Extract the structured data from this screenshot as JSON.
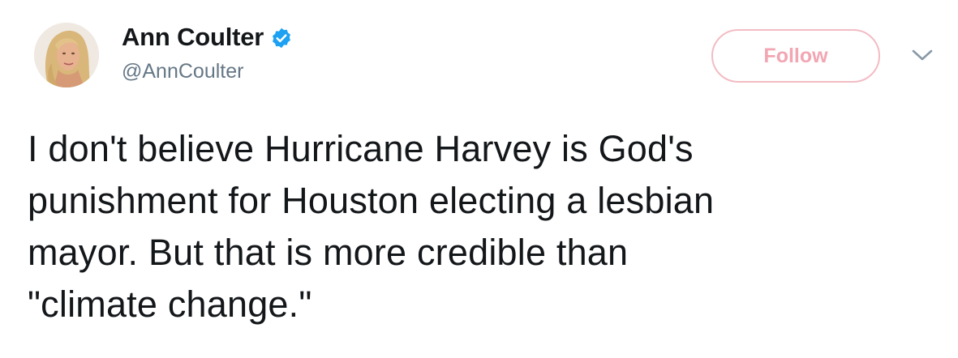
{
  "user": {
    "display_name": "Ann Coulter",
    "handle": "@AnnCoulter",
    "verified": true,
    "avatar_icon": "profile-photo"
  },
  "actions": {
    "follow_label": "Follow",
    "menu_icon": "chevron-down-icon"
  },
  "tweet": {
    "text": "I don't believe Hurricane Harvey is God's\npunishment for Houston electing a lesbian\nmayor. But that is more credible than\n\"climate change.\""
  },
  "colors": {
    "text": "#14171a",
    "handle": "#657786",
    "verified": "#1da1f2",
    "follow_border": "#f2bcc4",
    "follow_text": "#f2a6b3"
  }
}
